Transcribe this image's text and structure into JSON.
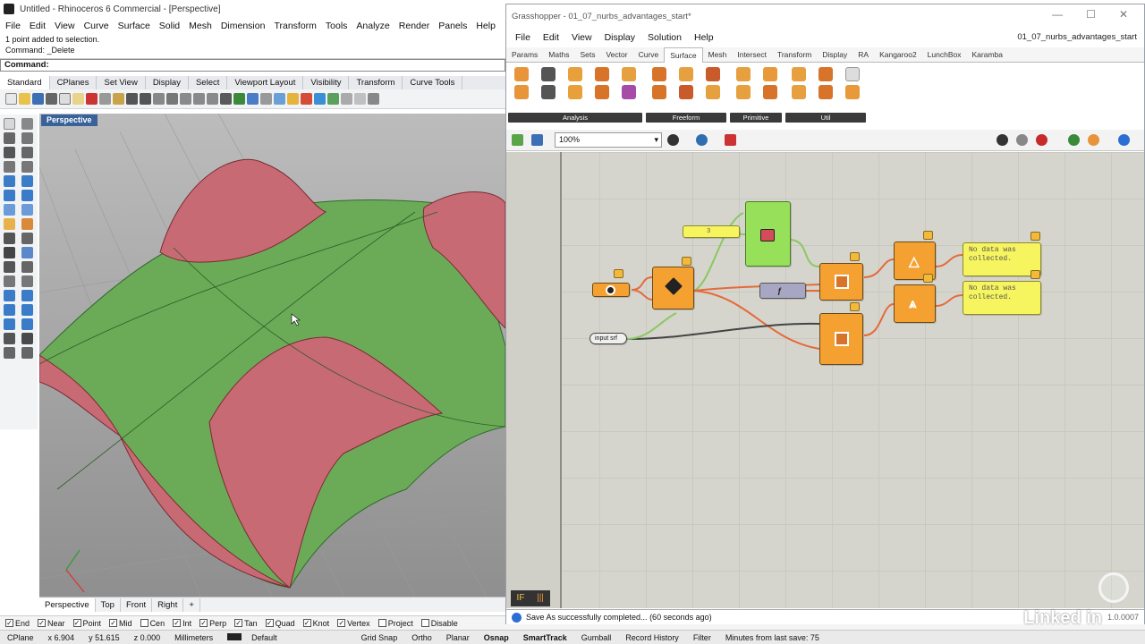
{
  "rhino": {
    "title": "Untitled - Rhinoceros 6 Commercial - [Perspective]",
    "menu": [
      "File",
      "Edit",
      "View",
      "Curve",
      "Surface",
      "Solid",
      "Mesh",
      "Dimension",
      "Transform",
      "Tools",
      "Analyze",
      "Render",
      "Panels",
      "Help"
    ],
    "command_history": [
      "1 point added to selection.",
      "Command: _Delete"
    ],
    "command_prompt": "Command:",
    "toolbar_tabs": [
      "Standard",
      "CPlanes",
      "Set View",
      "Display",
      "Select",
      "Viewport Layout",
      "Visibility",
      "Transform",
      "Curve Tools"
    ],
    "viewport_label": "Perspective",
    "viewport_tabs": [
      "Perspective",
      "Top",
      "Front",
      "Right"
    ],
    "osnaps": [
      {
        "label": "End",
        "checked": true
      },
      {
        "label": "Near",
        "checked": true
      },
      {
        "label": "Point",
        "checked": true
      },
      {
        "label": "Mid",
        "checked": true
      },
      {
        "label": "Cen",
        "checked": false
      },
      {
        "label": "Int",
        "checked": true
      },
      {
        "label": "Perp",
        "checked": true
      },
      {
        "label": "Tan",
        "checked": true
      },
      {
        "label": "Quad",
        "checked": true
      },
      {
        "label": "Knot",
        "checked": true
      },
      {
        "label": "Vertex",
        "checked": true
      },
      {
        "label": "Project",
        "checked": false
      },
      {
        "label": "Disable",
        "checked": false
      }
    ],
    "status": {
      "cplane": "CPlane",
      "x": "x 6.904",
      "y": "y 51.615",
      "z": "z 0.000",
      "units": "Millimeters",
      "layer": "Default",
      "grid_snap": "Grid Snap",
      "ortho": "Ortho",
      "planar": "Planar",
      "osnap": "Osnap",
      "smarttrack": "SmartTrack",
      "gumball": "Gumball",
      "record_history": "Record History",
      "filter": "Filter",
      "save_info": "Minutes from last save: 75"
    }
  },
  "grasshopper": {
    "title": "Grasshopper - 01_07_nurbs_advantages_start*",
    "window_controls": [
      "—",
      "☐",
      "✕"
    ],
    "menu": [
      "File",
      "Edit",
      "View",
      "Display",
      "Solution",
      "Help"
    ],
    "file_name": "01_07_nurbs_advantages_start",
    "tabs": [
      "Params",
      "Maths",
      "Sets",
      "Vector",
      "Curve",
      "Surface",
      "Mesh",
      "Intersect",
      "Transform",
      "Display",
      "RA",
      "Kangaroo2",
      "LunchBox",
      "Karamba"
    ],
    "active_tab": "Surface",
    "ribbon_groups": [
      "Analysis",
      "Freeform",
      "Primitive",
      "Util"
    ],
    "zoom": "100%",
    "nodes": {
      "slider_value": "3",
      "panel_1_text": "No data was collected.",
      "panel_2_text": "No data was collected.",
      "input_pill_label": "input srf"
    },
    "status_message": "Save As successfully completed... (60 seconds ago)",
    "version": "1.0.0007"
  },
  "watermark": "Linked in",
  "colors": {
    "surface_red": "#c86a74",
    "surface_green": "#6bab58",
    "viewport_bg": "#a8a8a8",
    "gh_canvas": "#d5d5ce",
    "gh_node_orange": "#f5a132",
    "gh_node_green": "#96e05a",
    "gh_panel_yellow": "#f7f55f",
    "rhino_accent": "#39629a"
  }
}
